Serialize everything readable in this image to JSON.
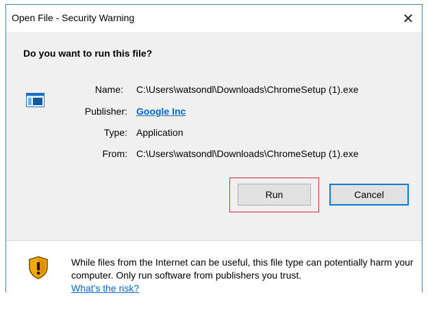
{
  "window": {
    "title": "Open File - Security Warning",
    "close_glyph": "✕"
  },
  "question": "Do you want to run this file?",
  "details": {
    "name_label": "Name:",
    "name_value": "C:\\Users\\watsondl\\Downloads\\ChromeSetup (1).exe",
    "publisher_label": "Publisher:",
    "publisher_value": "Google Inc",
    "type_label": "Type:",
    "type_value": "Application",
    "from_label": "From:",
    "from_value": "C:\\Users\\watsondl\\Downloads\\ChromeSetup (1).exe"
  },
  "buttons": {
    "run": "Run",
    "cancel": "Cancel"
  },
  "footer": {
    "warning_text": "While files from the Internet can be useful, this file type can potentially harm your computer. Only run software from publishers you trust.",
    "risk_link": "What's the risk?"
  },
  "colors": {
    "link": "#0066cc",
    "focus_border": "#0078d7",
    "highlight": "#d9232e",
    "shield": "#f2a900"
  },
  "icons": [
    "close-icon",
    "application-icon",
    "shield-warning-icon"
  ]
}
